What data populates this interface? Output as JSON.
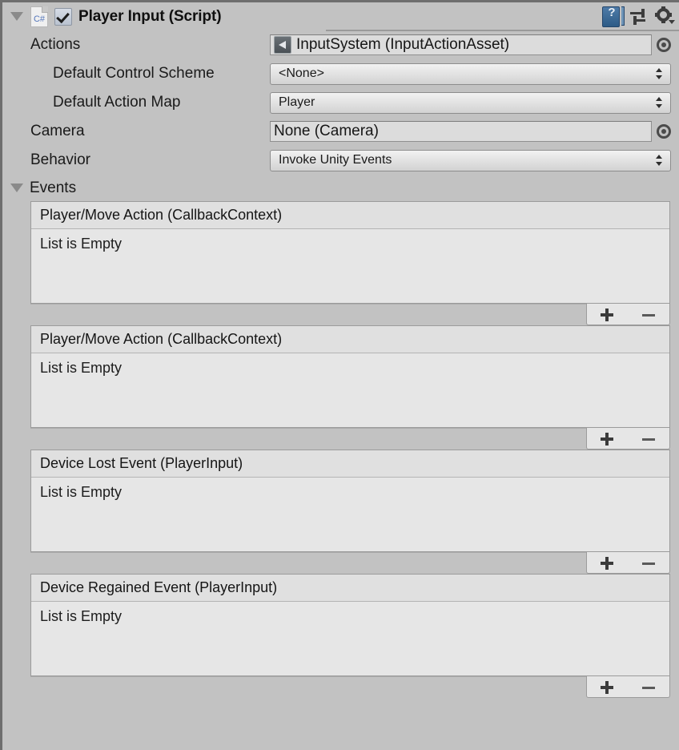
{
  "component": {
    "title": "Player Input (Script)",
    "script_icon_label": "C#",
    "enabled": true,
    "foldout_icon": "triangle-down-icon",
    "header_icons": [
      {
        "name": "help-icon",
        "label": "?"
      },
      {
        "name": "preset-icon",
        "label": ""
      },
      {
        "name": "gear-icon",
        "label": ""
      }
    ]
  },
  "properties": {
    "actions": {
      "label": "Actions",
      "value": "InputSystem (InputActionAsset)",
      "asset_icon": "unity-asset-icon",
      "picker_icon": "object-picker-icon"
    },
    "default_control_scheme": {
      "label": "Default Control Scheme",
      "value": "<None>"
    },
    "default_action_map": {
      "label": "Default Action Map",
      "value": "Player"
    },
    "camera": {
      "label": "Camera",
      "value": "None (Camera)",
      "picker_icon": "object-picker-icon"
    },
    "behavior": {
      "label": "Behavior",
      "value": "Invoke Unity Events"
    }
  },
  "events_section": {
    "label": "Events",
    "expanded": true,
    "empty_text": "List is Empty",
    "add_button_label": "+",
    "remove_button_label": "–",
    "lists": [
      {
        "header": "Player/Move Action (CallbackContext)",
        "empty_text": "List is Empty"
      },
      {
        "header": "Player/Move Action (CallbackContext)",
        "empty_text": "List is Empty"
      },
      {
        "header": "Device Lost Event (PlayerInput)",
        "empty_text": "List is Empty"
      },
      {
        "header": "Device Regained Event (PlayerInput)",
        "empty_text": "List is Empty"
      }
    ]
  },
  "colors": {
    "panel_background": "#c2c2c2",
    "list_background": "#e6e6e6",
    "list_header": "#e0e0e0",
    "field_background": "#dcdcdc",
    "text": "#1a1a1a",
    "script_accent": "#5577bb"
  }
}
